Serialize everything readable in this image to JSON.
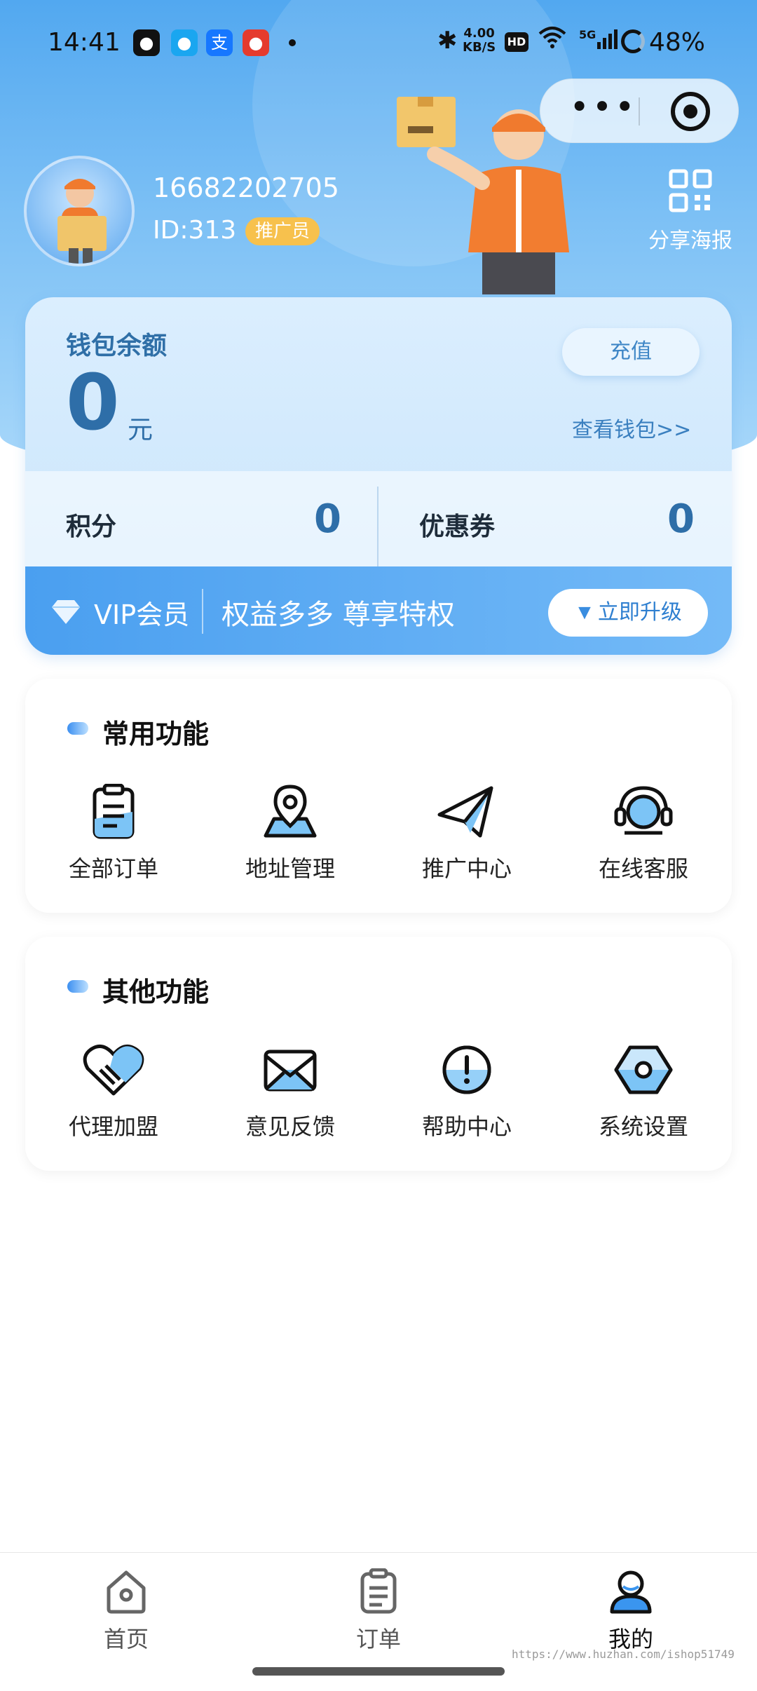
{
  "status_bar": {
    "time": "14:41",
    "speed_value": "4.00",
    "speed_unit": "KB/S",
    "hd": "HD",
    "network": "5G",
    "battery": "48%"
  },
  "profile": {
    "phone": "16682202705",
    "id": "ID:313",
    "badge": "推广员",
    "share_label": "分享海报"
  },
  "wallet": {
    "title": "钱包余额",
    "amount": "0",
    "unit": "元",
    "recharge_label": "充值",
    "view_wallet": "查看钱包>>",
    "points_label": "积分",
    "points_value": "0",
    "coupons_label": "优惠券",
    "coupons_value": "0"
  },
  "vip": {
    "label": "VIP会员",
    "slogan": "权益多多 尊享特权",
    "upgrade_label": "立即升级"
  },
  "common_section": {
    "title": "常用功能",
    "items": [
      {
        "label": "全部订单",
        "icon": "clipboard-icon"
      },
      {
        "label": "地址管理",
        "icon": "location-pin-icon"
      },
      {
        "label": "推广中心",
        "icon": "paper-plane-icon"
      },
      {
        "label": "在线客服",
        "icon": "headset-icon"
      }
    ]
  },
  "other_section": {
    "title": "其他功能",
    "items": [
      {
        "label": "代理加盟",
        "icon": "handshake-heart-icon"
      },
      {
        "label": "意见反馈",
        "icon": "envelope-icon"
      },
      {
        "label": "帮助中心",
        "icon": "info-circle-icon"
      },
      {
        "label": "系统设置",
        "icon": "hex-nut-icon"
      }
    ]
  },
  "tabbar": {
    "items": [
      {
        "label": "首页",
        "icon": "home-icon",
        "active": false
      },
      {
        "label": "订单",
        "icon": "orders-icon",
        "active": false
      },
      {
        "label": "我的",
        "icon": "user-icon",
        "active": true
      }
    ]
  },
  "watermark": "https://www.huzhan.com/ishop51749",
  "colors": {
    "primary": "#2e6ea8",
    "accent": "#4a9ff0",
    "badge": "#f7c14d"
  }
}
